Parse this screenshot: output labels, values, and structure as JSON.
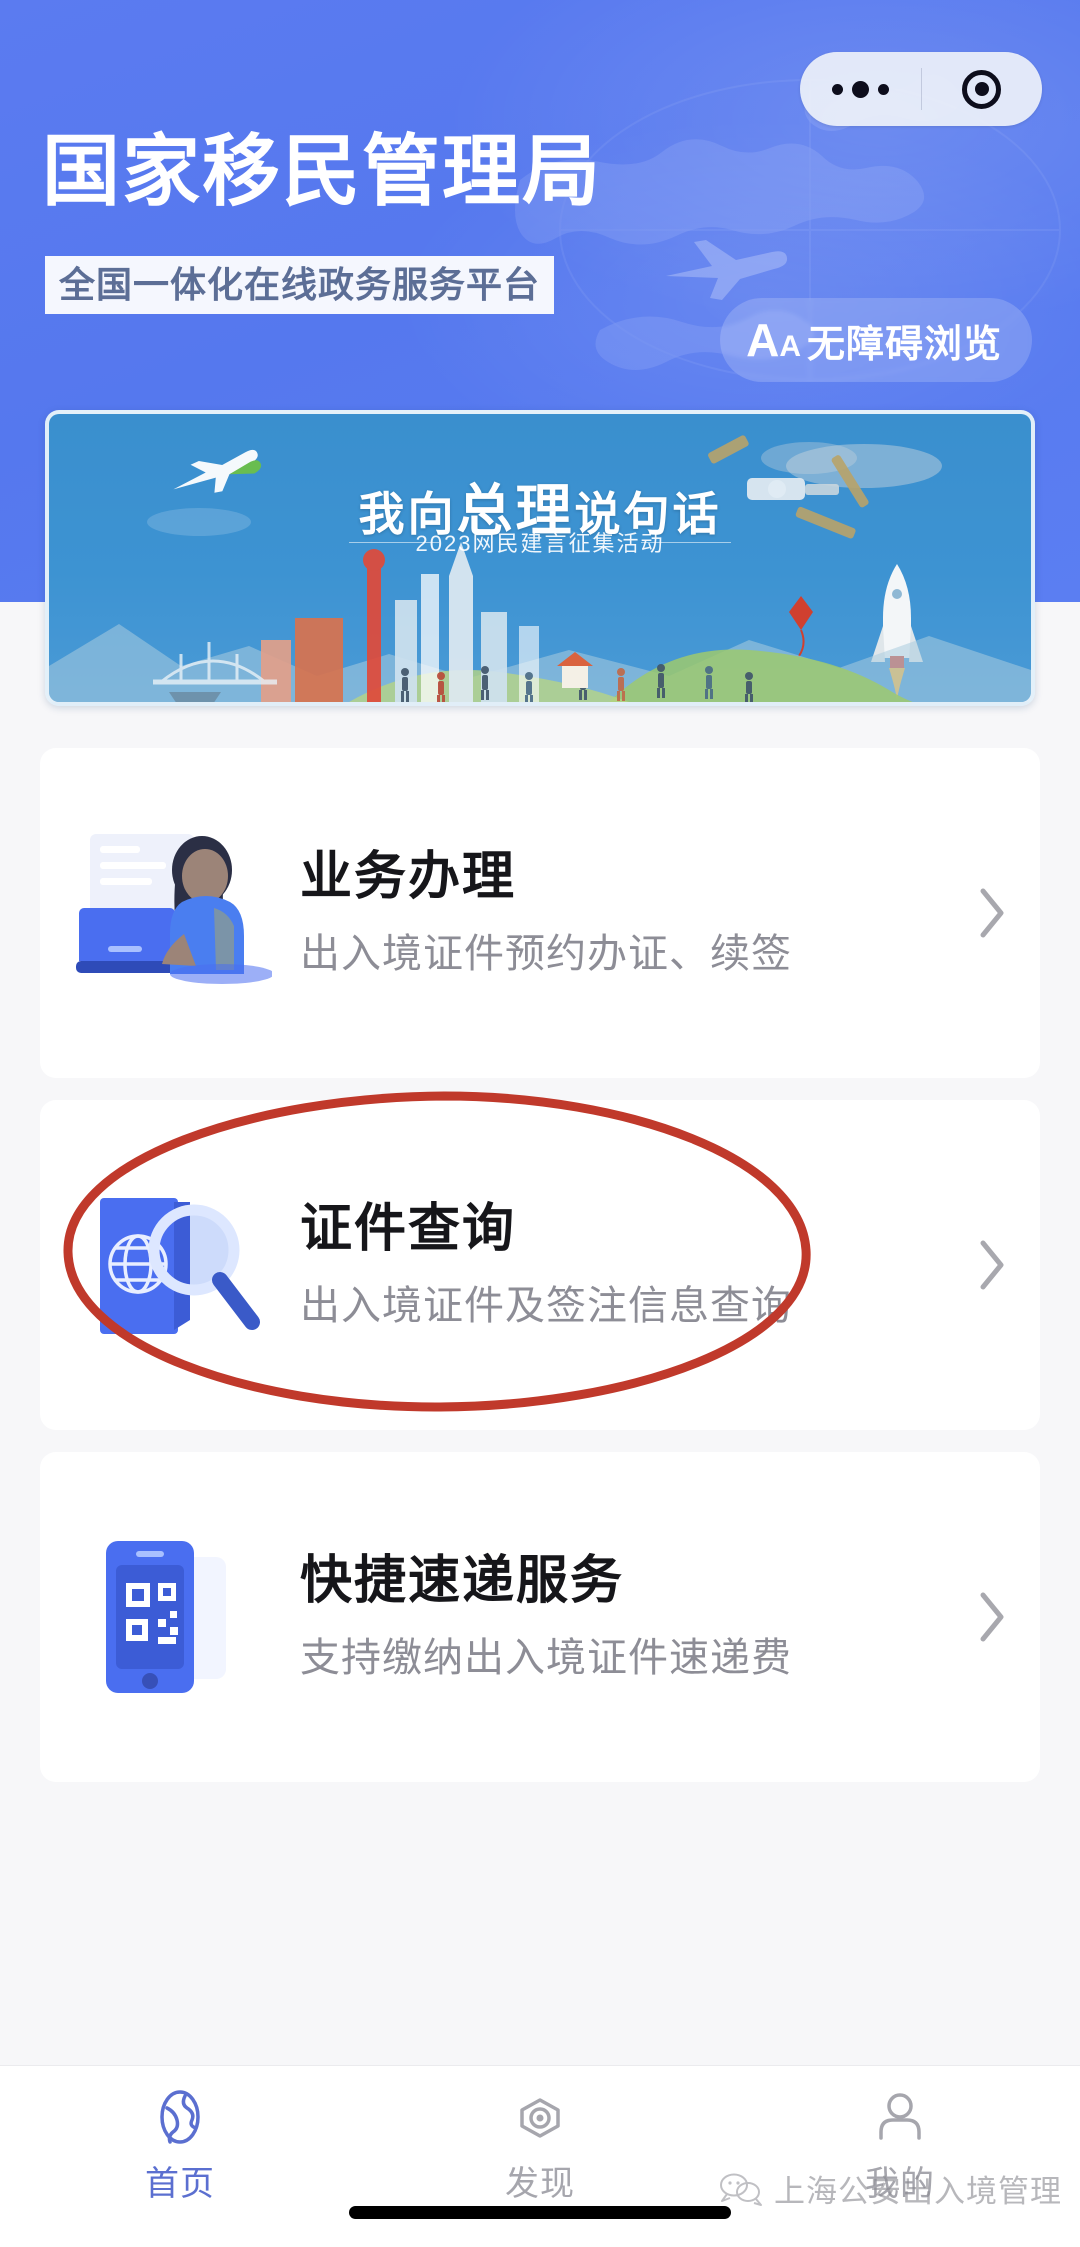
{
  "header": {
    "title": "国家移民管理局",
    "subtitle": "全国一体化在线政务服务平台",
    "capsule": {
      "more_icon": "more-dots-icon",
      "target_icon": "target-circle-icon"
    },
    "accessibility": {
      "aa_big": "A",
      "aa_small": "A",
      "label": "无障碍浏览"
    },
    "bg_color": "#5578ee"
  },
  "banner": {
    "title_part1": "我向",
    "title_emph": "总理",
    "title_part2": "说句话",
    "subtitle": "2023网民建言征集活动",
    "year": "2023",
    "bg_color": "#3d93d2"
  },
  "cards": [
    {
      "title": "业务办理",
      "desc": "出入境证件预约办证、续签",
      "icon": "person-laptop-icon",
      "chevron": "chevron-right-icon",
      "annotated": false
    },
    {
      "title": "证件查询",
      "desc": "出入境证件及签注信息查询",
      "icon": "passport-search-icon",
      "chevron": "chevron-right-icon",
      "annotated": true
    },
    {
      "title": "快捷速递服务",
      "desc": "支持缴纳出入境证件速递费",
      "icon": "phone-qrcode-icon",
      "chevron": "chevron-right-icon",
      "annotated": false
    }
  ],
  "annotation": {
    "color": "#c0392b",
    "shape": "ellipse",
    "target": "证件查询"
  },
  "tabbar": {
    "items": [
      {
        "label": "首页",
        "icon": "globe-icon",
        "active": true
      },
      {
        "label": "发现",
        "icon": "eye-icon",
        "active": false
      },
      {
        "label": "我的",
        "icon": "person-icon",
        "active": false
      }
    ],
    "active_color": "#5b6fd0",
    "inactive_color": "#a6a6ad"
  },
  "watermark": {
    "text": "上海公安出入境管理",
    "icon": "wechat-bubbles-icon"
  },
  "home_indicator": {
    "label": "home-indicator"
  }
}
